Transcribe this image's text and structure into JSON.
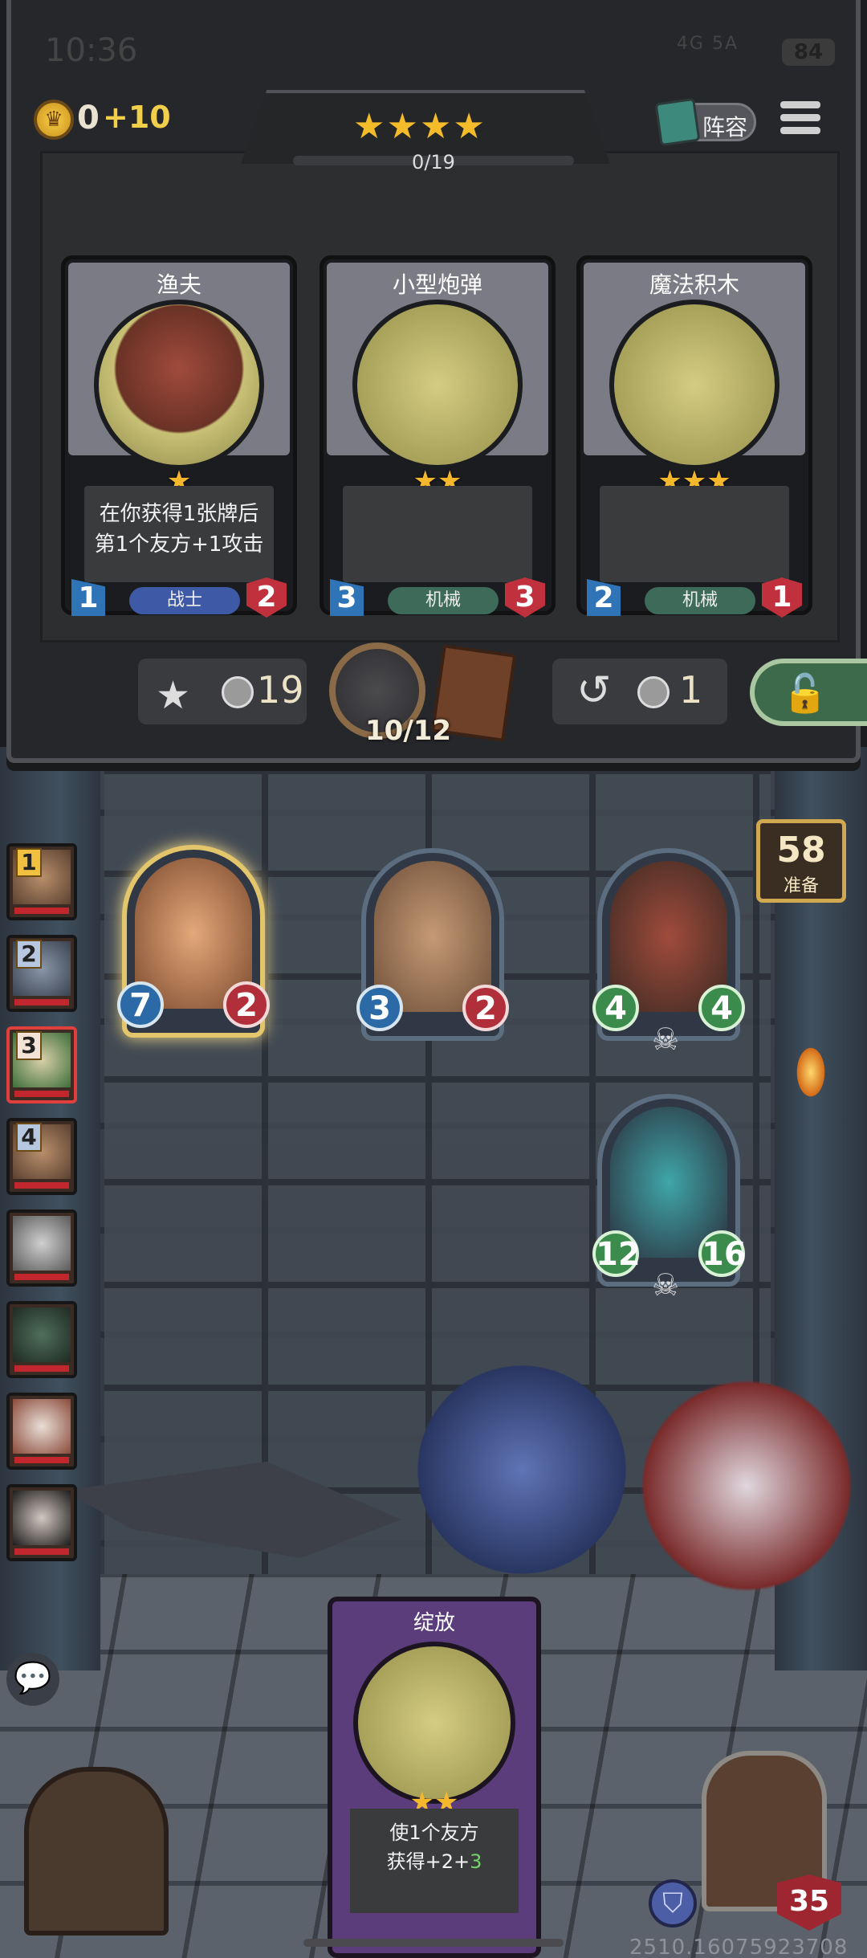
{
  "status_bar": {
    "time": "10:36",
    "signal": "4G  5A",
    "battery": "84"
  },
  "header": {
    "gold": "0",
    "gold_income": "+10",
    "tier_stars": "★★★★",
    "xp": "0/19",
    "lineup_label": "阵容"
  },
  "shop_cards": [
    {
      "name": "渔夫",
      "stars": "★",
      "desc_line1": "在你获得1张牌后",
      "desc_line2": "第1个友方+1攻击",
      "attack": "1",
      "health": "2",
      "tribe": "战士"
    },
    {
      "name": "小型炮弹",
      "stars": "★★",
      "desc_line1": "",
      "desc_line2": "",
      "attack": "3",
      "health": "3",
      "tribe": "机械"
    },
    {
      "name": "魔法积木",
      "stars": "★★★",
      "desc_line1": "",
      "desc_line2": "",
      "attack": "2",
      "health": "1",
      "tribe": "机械"
    }
  ],
  "shop_bar": {
    "upgrade_cost": "19",
    "round": "10/12",
    "refresh_cost": "1"
  },
  "board": [
    {
      "attack": "7",
      "health": "2"
    },
    {
      "attack": "3",
      "health": "2"
    },
    {
      "attack": "4",
      "health": "4"
    },
    {
      "attack": "12",
      "health": "16"
    }
  ],
  "players": [
    "1",
    "2",
    "3",
    "4",
    "",
    "",
    "",
    ""
  ],
  "ready": {
    "count": "58",
    "label": "准备"
  },
  "hand_card": {
    "name": "绽放",
    "stars": "★★",
    "desc_line1": "使1个友方",
    "desc_prefix": "获得+2+",
    "desc_green": "3"
  },
  "hero": {
    "health": "35"
  },
  "watermark": "2510.16075923708",
  "colors": {
    "gold": "#f4bb2b",
    "attack_blue": "#2b6aa6",
    "health_red": "#b12f3b",
    "warrior_tribe": "#3e5aa6",
    "mech_tribe": "#3e6a59"
  }
}
